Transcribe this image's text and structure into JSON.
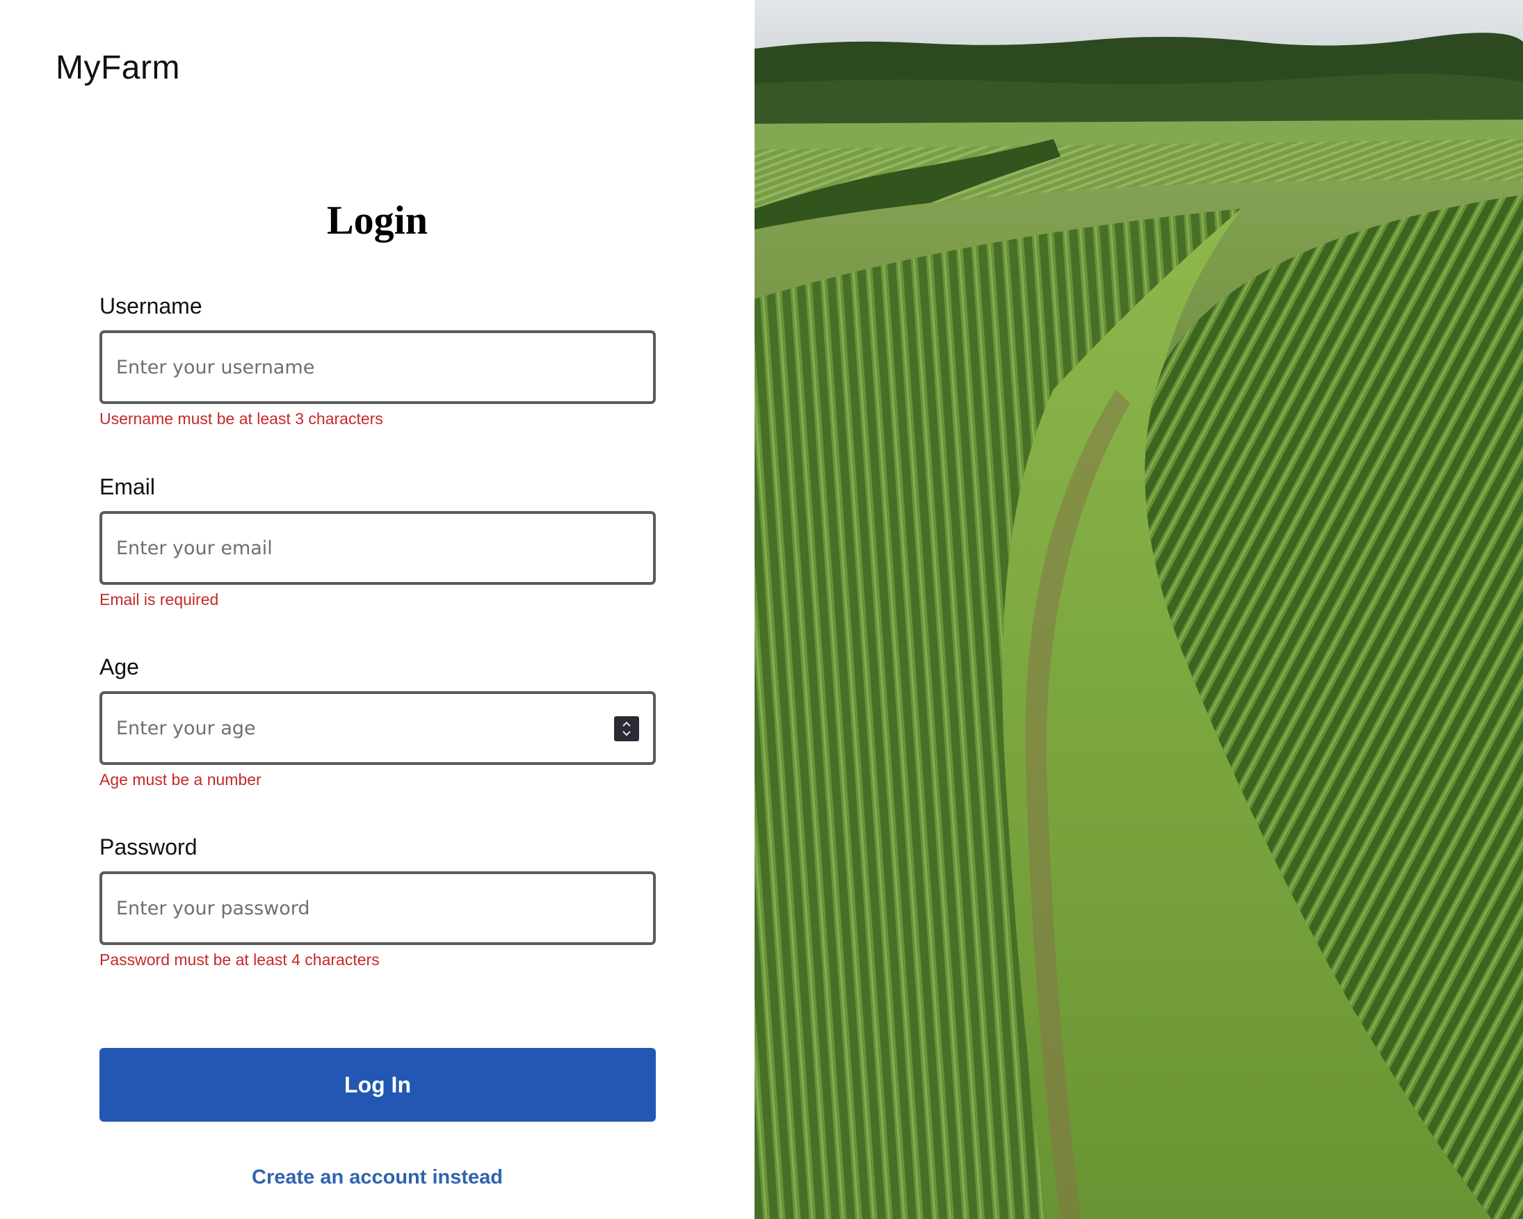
{
  "app": {
    "logo": "MyFarm"
  },
  "form": {
    "title": "Login",
    "fields": [
      {
        "label": "Username",
        "placeholder": "Enter your username",
        "error": "Username must be at least 3 characters",
        "type": "text"
      },
      {
        "label": "Email",
        "placeholder": "Enter your email",
        "error": "Email is required",
        "type": "email"
      },
      {
        "label": "Age",
        "placeholder": "Enter your age",
        "error": "Age must be a number",
        "type": "number"
      },
      {
        "label": "Password",
        "placeholder": "Enter your password",
        "error": "Password must be at least 4 characters",
        "type": "password"
      }
    ],
    "submit_label": "Log In",
    "alt_link": "Create an account instead"
  },
  "hero": {
    "subject": "aerial view of green corn field rows"
  },
  "colors": {
    "primary_button": "#2257b3",
    "error_text": "#c62828",
    "link": "#2f64b0",
    "input_border": "#5a5a5a"
  },
  "icons": {
    "age_stepper": "number-stepper-icon"
  }
}
